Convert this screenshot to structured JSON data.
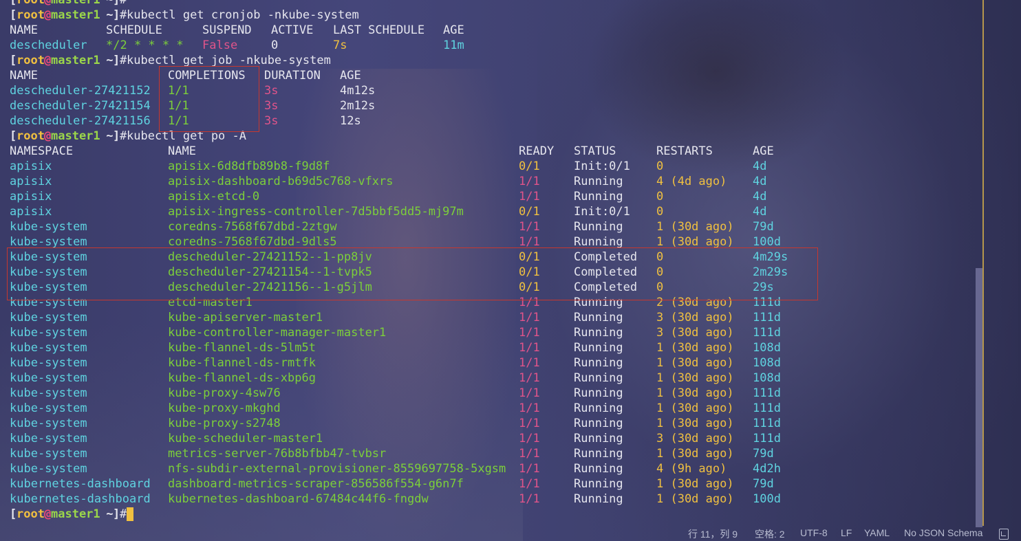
{
  "prompt": {
    "open": "[",
    "user": "root",
    "at": "@",
    "host": "master1",
    "tilde": " ~",
    "close": "]",
    "hash": "#"
  },
  "commands": {
    "first": "",
    "cronjob": "kubectl get cronjob -nkube-system",
    "job": "kubectl get job -nkube-system",
    "pods": "kubectl get po -A",
    "last": ""
  },
  "cronjob_table": {
    "headers": [
      "NAME",
      "SCHEDULE",
      "SUSPEND",
      "ACTIVE",
      "LAST SCHEDULE",
      "AGE"
    ],
    "rows": [
      {
        "name": "descheduler",
        "schedule": "*/2 * * * *",
        "suspend": "False",
        "active": "0",
        "last": "7s",
        "age": "11m"
      }
    ]
  },
  "job_table": {
    "headers": [
      "NAME",
      "COMPLETIONS",
      "DURATION",
      "AGE"
    ],
    "rows": [
      {
        "name": "descheduler-27421152",
        "completions": "1/1",
        "duration": "3s",
        "age": "4m12s"
      },
      {
        "name": "descheduler-27421154",
        "completions": "1/1",
        "duration": "3s",
        "age": "2m12s"
      },
      {
        "name": "descheduler-27421156",
        "completions": "1/1",
        "duration": "3s",
        "age": "12s"
      }
    ]
  },
  "pod_table": {
    "headers": [
      "NAMESPACE",
      "NAME",
      "READY",
      "STATUS",
      "RESTARTS",
      "AGE"
    ],
    "rows": [
      {
        "ns": "apisix",
        "name": "apisix-6d8dfb89b8-f9d8f",
        "ready": "0/1",
        "status": "Init:0/1",
        "restarts": "0",
        "age": "4d"
      },
      {
        "ns": "apisix",
        "name": "apisix-dashboard-b69d5c768-vfxrs",
        "ready": "1/1",
        "status": "Running",
        "restarts": "4 (4d ago)",
        "age": "4d"
      },
      {
        "ns": "apisix",
        "name": "apisix-etcd-0",
        "ready": "1/1",
        "status": "Running",
        "restarts": "0",
        "age": "4d"
      },
      {
        "ns": "apisix",
        "name": "apisix-ingress-controller-7d5bbf5dd5-mj97m",
        "ready": "0/1",
        "status": "Init:0/1",
        "restarts": "0",
        "age": "4d"
      },
      {
        "ns": "kube-system",
        "name": "coredns-7568f67dbd-2ztgw",
        "ready": "1/1",
        "status": "Running",
        "restarts": "1 (30d ago)",
        "age": "79d"
      },
      {
        "ns": "kube-system",
        "name": "coredns-7568f67dbd-9dls5",
        "ready": "1/1",
        "status": "Running",
        "restarts": "1 (30d ago)",
        "age": "100d"
      },
      {
        "ns": "kube-system",
        "name": "descheduler-27421152--1-pp8jv",
        "ready": "0/1",
        "status": "Completed",
        "restarts": "0",
        "age": "4m29s"
      },
      {
        "ns": "kube-system",
        "name": "descheduler-27421154--1-tvpk5",
        "ready": "0/1",
        "status": "Completed",
        "restarts": "0",
        "age": "2m29s"
      },
      {
        "ns": "kube-system",
        "name": "descheduler-27421156--1-g5jlm",
        "ready": "0/1",
        "status": "Completed",
        "restarts": "0",
        "age": "29s"
      },
      {
        "ns": "kube-system",
        "name": "etcd-master1",
        "ready": "1/1",
        "status": "Running",
        "restarts": "2 (30d ago)",
        "age": "111d"
      },
      {
        "ns": "kube-system",
        "name": "kube-apiserver-master1",
        "ready": "1/1",
        "status": "Running",
        "restarts": "3 (30d ago)",
        "age": "111d"
      },
      {
        "ns": "kube-system",
        "name": "kube-controller-manager-master1",
        "ready": "1/1",
        "status": "Running",
        "restarts": "3 (30d ago)",
        "age": "111d"
      },
      {
        "ns": "kube-system",
        "name": "kube-flannel-ds-5lm5t",
        "ready": "1/1",
        "status": "Running",
        "restarts": "1 (30d ago)",
        "age": "108d"
      },
      {
        "ns": "kube-system",
        "name": "kube-flannel-ds-rmtfk",
        "ready": "1/1",
        "status": "Running",
        "restarts": "1 (30d ago)",
        "age": "108d"
      },
      {
        "ns": "kube-system",
        "name": "kube-flannel-ds-xbp6g",
        "ready": "1/1",
        "status": "Running",
        "restarts": "1 (30d ago)",
        "age": "108d"
      },
      {
        "ns": "kube-system",
        "name": "kube-proxy-4sw76",
        "ready": "1/1",
        "status": "Running",
        "restarts": "1 (30d ago)",
        "age": "111d"
      },
      {
        "ns": "kube-system",
        "name": "kube-proxy-mkghd",
        "ready": "1/1",
        "status": "Running",
        "restarts": "1 (30d ago)",
        "age": "111d"
      },
      {
        "ns": "kube-system",
        "name": "kube-proxy-s2748",
        "ready": "1/1",
        "status": "Running",
        "restarts": "1 (30d ago)",
        "age": "111d"
      },
      {
        "ns": "kube-system",
        "name": "kube-scheduler-master1",
        "ready": "1/1",
        "status": "Running",
        "restarts": "3 (30d ago)",
        "age": "111d"
      },
      {
        "ns": "kube-system",
        "name": "metrics-server-76b8bfbb47-tvbsr",
        "ready": "1/1",
        "status": "Running",
        "restarts": "1 (30d ago)",
        "age": "79d"
      },
      {
        "ns": "kube-system",
        "name": "nfs-subdir-external-provisioner-8559697758-5xgsm",
        "ready": "1/1",
        "status": "Running",
        "restarts": "4 (9h ago)",
        "age": "4d2h"
      },
      {
        "ns": "kubernetes-dashboard",
        "name": "dashboard-metrics-scraper-856586f554-g6n7f",
        "ready": "1/1",
        "status": "Running",
        "restarts": "1 (30d ago)",
        "age": "79d"
      },
      {
        "ns": "kubernetes-dashboard",
        "name": "kubernetes-dashboard-67484c44f6-fngdw",
        "ready": "1/1",
        "status": "Running",
        "restarts": "1 (30d ago)",
        "age": "100d"
      }
    ]
  },
  "status_bar": {
    "position": "行 11，列 9",
    "indent": "空格: 2",
    "encoding": "UTF-8",
    "eol": "LF",
    "language": "YAML",
    "schema": "No JSON Schema",
    "notification_icon": "bell-icon"
  },
  "colors": {
    "background": "#3e3f6c",
    "cyan": "#5fd3e0",
    "green": "#7ccf3a",
    "pink": "#e0548a",
    "yellow": "#f0c040",
    "highlight_box": "#c8382e"
  }
}
